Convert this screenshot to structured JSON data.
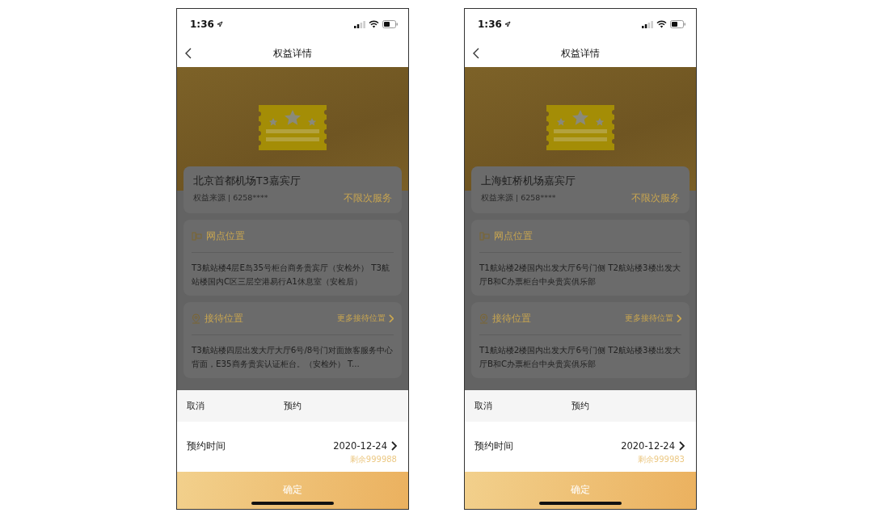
{
  "phones": [
    {
      "status_bar": {
        "time": "1:36"
      },
      "nav": {
        "title": "权益详情"
      },
      "benefit": {
        "name": "北京首都机场T3嘉宾厅",
        "source": "权益来源 | 6258****",
        "badge": "不限次服务"
      },
      "sections": [
        {
          "kind": "outlet",
          "title": "网点位置",
          "text": "T3航站楼4层E岛35号柜台商务贵宾厅（安检外） T3航站楼国内C区三层空港易行A1休息室（安检后）"
        },
        {
          "kind": "reception",
          "title": "接待位置",
          "link": "更多接待位置",
          "text": "T3航站楼四层出发大厅大厅6号/8号门对面旅客服务中心背面，E35商务贵宾认证柜台。（安检外） T..."
        }
      ],
      "sheet": {
        "cancel": "取消",
        "title": "预约",
        "field_label": "预约时间",
        "date": "2020-12-24",
        "remaining": "剩余999988",
        "confirm": "确定"
      }
    },
    {
      "status_bar": {
        "time": "1:36"
      },
      "nav": {
        "title": "权益详情"
      },
      "benefit": {
        "name": "上海虹桥机场嘉宾厅",
        "source": "权益来源 | 6258****",
        "badge": "不限次服务"
      },
      "sections": [
        {
          "kind": "outlet",
          "title": "网点位置",
          "text": "T1航站楼2楼国内出发大厅6号门侧 T2航站楼3楼出发大厅B和C办票柜台中央贵宾俱乐部"
        },
        {
          "kind": "reception",
          "title": "接待位置",
          "link": "更多接待位置",
          "text": "T1航站楼2楼国内出发大厅6号门侧 T2航站楼3楼出发大厅B和C办票柜台中央贵宾俱乐部"
        }
      ],
      "sheet": {
        "cancel": "取消",
        "title": "预约",
        "field_label": "预约时间",
        "date": "2020-12-24",
        "remaining": "剩余999983",
        "confirm": "确定"
      }
    }
  ]
}
